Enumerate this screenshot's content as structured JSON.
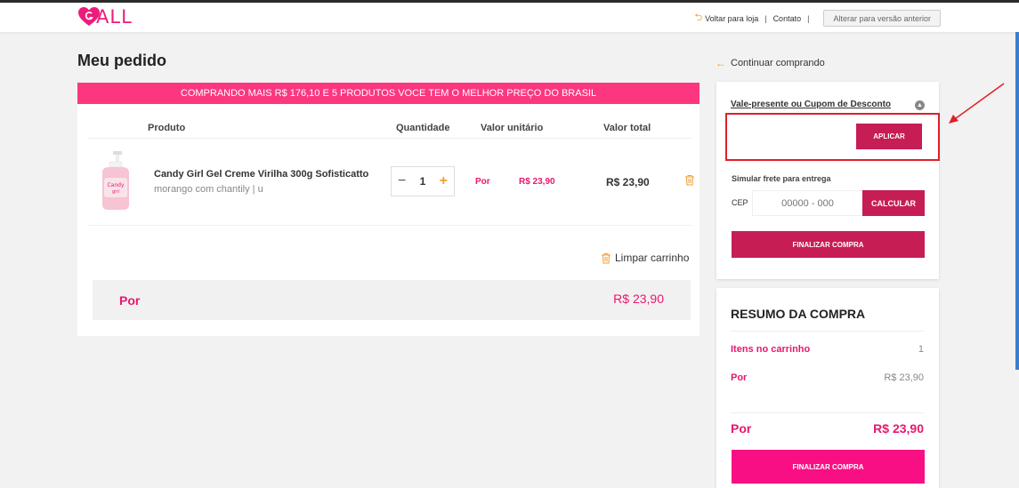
{
  "header": {
    "logo_text": "ALL",
    "back_to_store": "Voltar para loja",
    "contact": "Contato",
    "old_version_button": "Alterar para versão anterior"
  },
  "page": {
    "title": "Meu pedido",
    "continue_shopping": "Continuar comprando"
  },
  "cart": {
    "promo_banner": "COMPRANDO MAIS R$  176,10 E 5 PRODUTOS VOCE TEM O MELHOR PREÇO DO BRASIL",
    "columns": {
      "product": "Produto",
      "quantity": "Quantidade",
      "unit_price": "Valor unitário",
      "total": "Valor total"
    },
    "items": [
      {
        "name": "Candy Girl Gel Creme Virilha 300g Sofisticatto",
        "variant": "morango com chantily  |  u",
        "quantity": "1",
        "minus": "−",
        "plus": "+",
        "unit_label": "Por",
        "unit_price": "R$ 23,90",
        "total": "R$ 23,90"
      }
    ],
    "clear_cart": "Limpar carrinho",
    "subtotal_label": "Por",
    "subtotal_value": "R$ 23,90"
  },
  "coupon": {
    "title": "Vale-presente ou Cupom de Desconto",
    "input_value": "",
    "apply_button": "APLICAR",
    "shipping_label": "Simular frete para entrega",
    "cep_label": "CEP",
    "cep_placeholder": "00000 - 000",
    "calculate_button": "CALCULAR",
    "finish_button": "FINALIZAR COMPRA"
  },
  "summary": {
    "title": "RESUMO DA COMPRA",
    "items_label": "Itens no carrinho",
    "items_value": "1",
    "por_label": "Por",
    "por_value": "R$ 23,90",
    "total_label": "Por",
    "total_value": "R$ 23,90",
    "finish_button": "FINALIZAR COMPRA"
  },
  "colors": {
    "brand_pink": "#ec1c7c",
    "banner_pink": "#fc3780",
    "button_crimson": "#c61d55",
    "button_hot_pink": "#f90f84",
    "accent_orange": "#f39c2b",
    "annotation_red": "#e11e28"
  },
  "icons": [
    "heart-logo-icon",
    "back-arrow-icon",
    "left-arrow-icon",
    "trash-icon",
    "chevron-up-icon"
  ]
}
